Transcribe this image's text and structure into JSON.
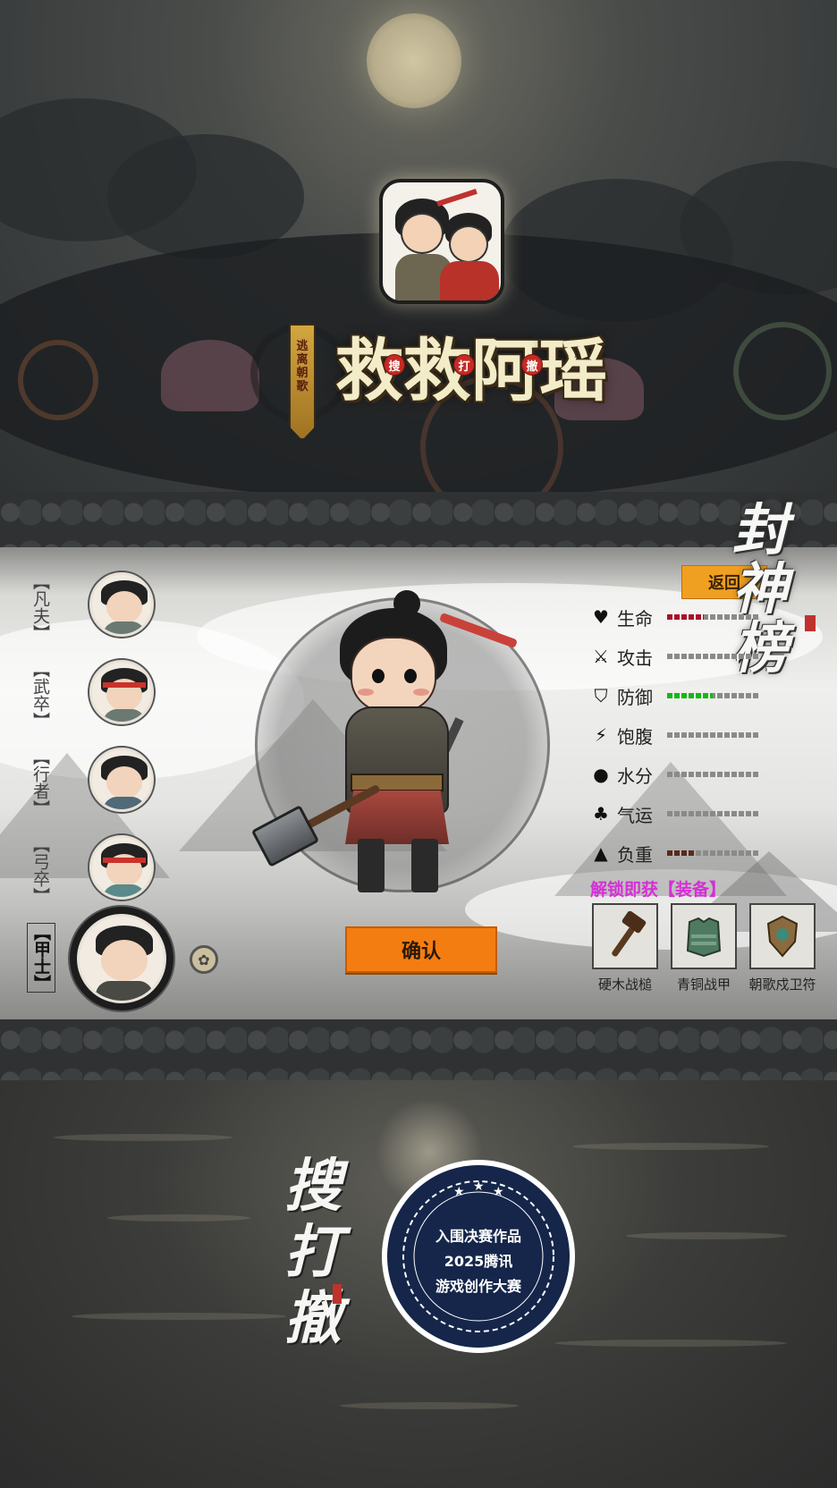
{
  "top": {
    "title_chars": [
      "救",
      "救",
      "阿",
      "瑶"
    ],
    "seal_chars": [
      "搜",
      "打",
      "撤"
    ],
    "sword_badge_chars": [
      "逃",
      "离",
      "朝",
      "歌"
    ]
  },
  "game_screen": {
    "ranks": [
      {
        "label": "【凡夫】",
        "selected": false
      },
      {
        "label": "【武卒】",
        "selected": false
      },
      {
        "label": "【行者】",
        "selected": false
      },
      {
        "label": "【弓卒】",
        "selected": false
      },
      {
        "label": "【甲士】",
        "selected": true
      }
    ],
    "back_button": "返回",
    "logo_chars": [
      "封",
      "神",
      "榜"
    ],
    "stats": [
      {
        "label": "生命",
        "icon": "heart-icon",
        "glyph": "♥",
        "fill": 0.4,
        "color": "#a8102a"
      },
      {
        "label": "攻击",
        "icon": "swords-icon",
        "glyph": "⚔",
        "fill": 0,
        "color": "#8a8a8a"
      },
      {
        "label": "防御",
        "icon": "shield-icon",
        "glyph": "⛉",
        "fill": 0.5,
        "color": "#16b816"
      },
      {
        "label": "饱腹",
        "icon": "bolt-icon",
        "glyph": "⚡",
        "fill": 0,
        "color": "#8a8a8a"
      },
      {
        "label": "水分",
        "icon": "water-drop-icon",
        "glyph": "●",
        "fill": 0,
        "color": "#8a8a8a"
      },
      {
        "label": "气运",
        "icon": "clover-icon",
        "glyph": "♣",
        "fill": 0,
        "color": "#8a8a8a"
      },
      {
        "label": "负重",
        "icon": "weight-icon",
        "glyph": "▲",
        "fill": 0.3,
        "color": "#5a2a1a"
      }
    ],
    "unlock_title": "解锁即获【装备】",
    "equipment": [
      {
        "name": "硬木战槌",
        "icon": "war-hammer-icon"
      },
      {
        "name": "青铜战甲",
        "icon": "bronze-armor-icon"
      },
      {
        "name": "朝歌戍卫符",
        "icon": "shield-amulet-icon"
      }
    ],
    "confirm_button": "确认"
  },
  "bottom": {
    "logo_chars": [
      "搜",
      "打",
      "撤"
    ],
    "award_lines": [
      "入围决赛作品",
      "2025腾讯",
      "游戏创作大赛"
    ]
  }
}
